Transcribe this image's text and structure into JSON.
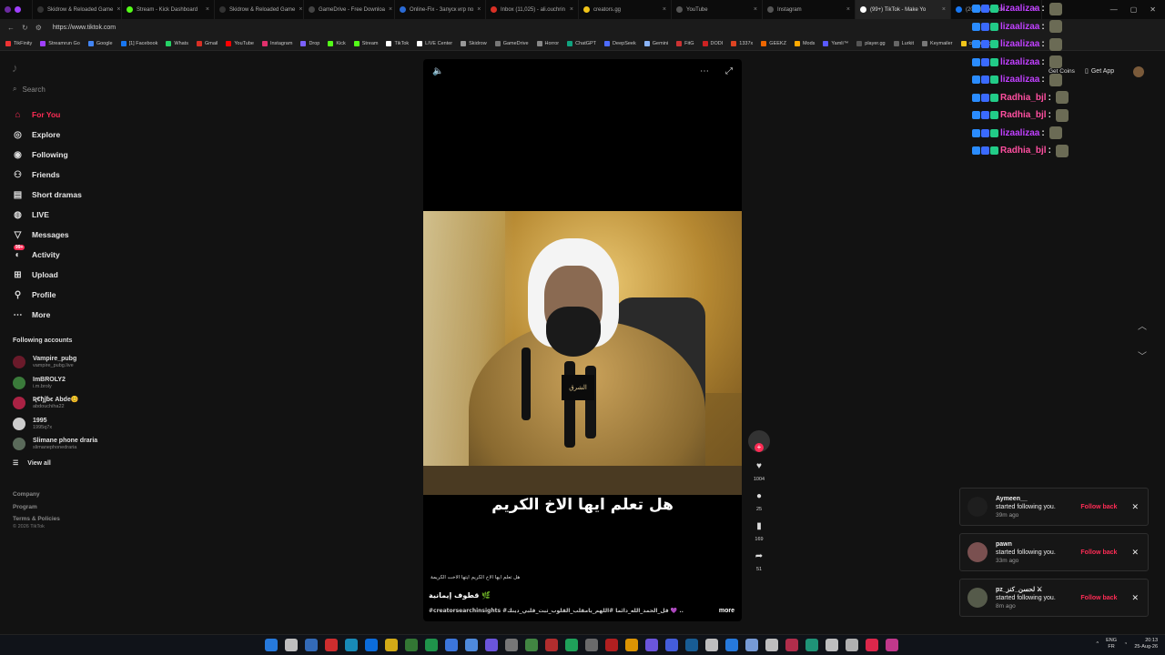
{
  "browser": {
    "tabs": [
      {
        "title": "Skidrow & Reloaded Game",
        "color": "#333333",
        "active": false
      },
      {
        "title": "Stream - Kick Dashboard",
        "color": "#53fc18",
        "active": false
      },
      {
        "title": "Skidrow & Reloaded Game",
        "color": "#333333",
        "active": false
      },
      {
        "title": "GameDrive - Free Downloa",
        "color": "#444444",
        "active": false
      },
      {
        "title": "Online-Fix - Запуск игр по",
        "color": "#2a6ad4",
        "active": false
      },
      {
        "title": "Inbox (11,025) - ali.ouchrin",
        "color": "#d93025",
        "active": false
      },
      {
        "title": "creators.gg",
        "color": "#f0c419",
        "active": false
      },
      {
        "title": "YouTube",
        "color": "#555555",
        "active": false
      },
      {
        "title": "Instagram",
        "color": "#555555",
        "active": false
      },
      {
        "title": "(99+) TikTok - Make Yo",
        "color": "#ffffff",
        "active": true
      },
      {
        "title": "(20+) Facebook",
        "color": "#1877f2",
        "active": false
      }
    ],
    "url": "https://www.tiktok.com",
    "bookmarks": [
      {
        "label": "TikFinity",
        "color": "#e33"
      },
      {
        "label": "Streamrun Go",
        "color": "#a040ff"
      },
      {
        "label": "Google",
        "color": "#4285f4"
      },
      {
        "label": "[1] Facebook",
        "color": "#1877f2"
      },
      {
        "label": "Whats",
        "color": "#25d366"
      },
      {
        "label": "Gmail",
        "color": "#d93025"
      },
      {
        "label": "YouTube",
        "color": "#ff0000"
      },
      {
        "label": "Instagram",
        "color": "#e1306c"
      },
      {
        "label": "Drop",
        "color": "#7b61ff"
      },
      {
        "label": "Kick",
        "color": "#53fc18"
      },
      {
        "label": "Stream",
        "color": "#53fc18"
      },
      {
        "label": "TikTok",
        "color": "#ffffff"
      },
      {
        "label": "LIVE Center",
        "color": "#ffffff"
      },
      {
        "label": "Skidrow",
        "color": "#999999"
      },
      {
        "label": "GameDrive",
        "color": "#777777"
      },
      {
        "label": "Horror",
        "color": "#888888"
      },
      {
        "label": "ChatGPT",
        "color": "#10a37f"
      },
      {
        "label": "DeepSeek",
        "color": "#4d6bfe"
      },
      {
        "label": "Gemini",
        "color": "#8ab4f8"
      },
      {
        "label": "FitG",
        "color": "#cc3333"
      },
      {
        "label": "DODI",
        "color": "#cc2222"
      },
      {
        "label": "1337x",
        "color": "#dd4422"
      },
      {
        "label": "GEEKZ",
        "color": "#ee6600"
      },
      {
        "label": "Mods",
        "color": "#ffaa00"
      },
      {
        "label": "Yamli™",
        "color": "#5a5aff"
      },
      {
        "label": "player.gg",
        "color": "#555555"
      },
      {
        "label": "Lurkit",
        "color": "#666666"
      },
      {
        "label": "Keymailer",
        "color": "#777777"
      },
      {
        "label": "creators.gg",
        "color": "#f0c419"
      }
    ]
  },
  "tiktok": {
    "search_placeholder": "Search",
    "nav": [
      {
        "label": "For You",
        "icon": "home-icon",
        "active": true
      },
      {
        "label": "Explore",
        "icon": "compass-icon",
        "active": false
      },
      {
        "label": "Following",
        "icon": "following-icon",
        "active": false
      },
      {
        "label": "Friends",
        "icon": "friends-icon",
        "active": false
      },
      {
        "label": "Short dramas",
        "icon": "drama-icon",
        "active": false
      },
      {
        "label": "LIVE",
        "icon": "live-icon",
        "active": false
      },
      {
        "label": "Messages",
        "icon": "send-icon",
        "active": false
      },
      {
        "label": "Activity",
        "icon": "bell-icon",
        "active": false,
        "badge": "99+"
      },
      {
        "label": "Upload",
        "icon": "plus-icon",
        "active": false
      },
      {
        "label": "Profile",
        "icon": "profile-icon",
        "active": false
      },
      {
        "label": "More",
        "icon": "more-icon",
        "active": false
      }
    ],
    "following_heading": "Following accounts",
    "following": [
      {
        "name": "Vampire_pubg",
        "handle": "vampire_pubg.live",
        "color": "#6a1a2a"
      },
      {
        "name": "ImBROLY2",
        "handle": "i.m.broly",
        "color": "#3a7a3a"
      },
      {
        "name": "Ʀ€ђĵɓϵ Abde😊",
        "handle": "abdouchiha22",
        "color": "#aa2244"
      },
      {
        "name": "1995",
        "handle": "1995q7x",
        "color": "#cccccc"
      },
      {
        "name": "Slimane phone draria",
        "handle": "slimanephonedraria",
        "color": "#5a6a5a"
      }
    ],
    "view_all": "View all",
    "footer": [
      "Company",
      "Program",
      "Terms & Policies"
    ],
    "copyright": "© 2026 TikTok",
    "get_coins": "Get Coins",
    "get_app": "Get App"
  },
  "video": {
    "subtitle": "هل تعلم ايها الاخ الكريم",
    "caption_small": "هل تعلم ايها الاخ الكريم ايتها الاخت الكريمة",
    "mic_label": "الشرق",
    "desc_title": "قطوف إيمانية 🌿",
    "desc_tags": "#creatorsearchinsights #قل_الحمد_الله_دائماً #اللهم_يامقلب_القلوب_ثبت_قلبي_دينك 💜 ...",
    "more_label": "more",
    "likes": "1004",
    "comments": "25",
    "saves": "169",
    "shares": "51"
  },
  "chat": [
    {
      "user": "lizaalizaa",
      "color": "#c040ff"
    },
    {
      "user": "lizaalizaa",
      "color": "#c040ff"
    },
    {
      "user": "lizaalizaa",
      "color": "#c040ff"
    },
    {
      "user": "lizaalizaa",
      "color": "#c040ff"
    },
    {
      "user": "lizaalizaa",
      "color": "#c040ff"
    },
    {
      "user": "Radhia_bjl",
      "color": "#ff4fa0"
    },
    {
      "user": "Radhia_bjl",
      "color": "#ff4fa0"
    },
    {
      "user": "lizaalizaa",
      "color": "#c040ff"
    },
    {
      "user": "Radhia_bjl",
      "color": "#ff4fa0"
    }
  ],
  "notifications": [
    {
      "user": "Aymeen__",
      "message": "started following you.",
      "time": "39m ago",
      "action": "Follow back"
    },
    {
      "user": "pawn",
      "message": "started following you.",
      "time": "33m ago",
      "action": "Follow back"
    },
    {
      "user": "pz_لحسن_كنز ⚔",
      "message": "started following you.",
      "time": "8m ago",
      "action": "Follow back"
    }
  ],
  "taskbar": {
    "lang": "ENG",
    "layout": "FR",
    "time": "20:13",
    "date": "25-Aug-26"
  }
}
